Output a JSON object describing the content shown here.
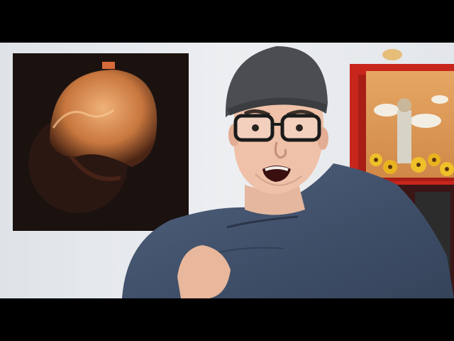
{
  "scene": {
    "letterbox_color": "#000000",
    "wall_color": "#e9ecef",
    "shelf_color": "#c8261d",
    "elements": [
      "left-wall-poster",
      "person-with-beanie-and-glasses",
      "denim-jacket",
      "red-record-shelf",
      "album-cover-with-sunflowers",
      "hanging-clip"
    ]
  }
}
